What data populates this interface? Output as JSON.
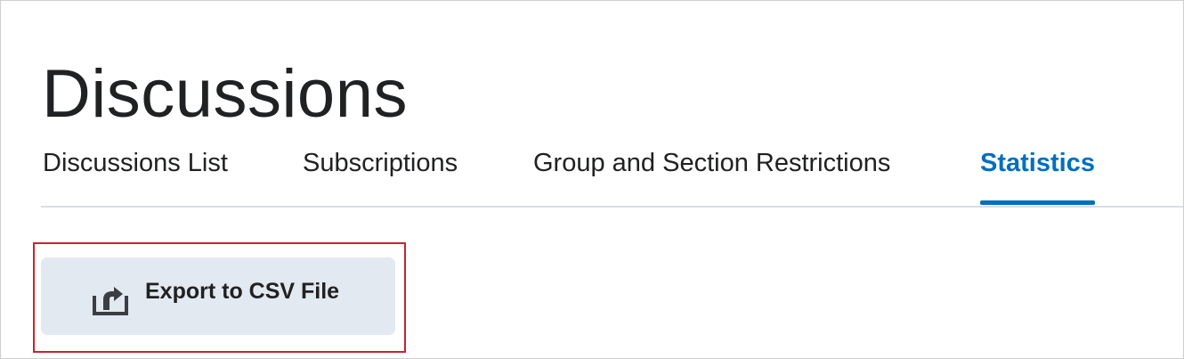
{
  "page": {
    "title": "Discussions"
  },
  "tabs": [
    {
      "label": "Discussions List",
      "active": false
    },
    {
      "label": "Subscriptions",
      "active": false
    },
    {
      "label": "Group and Section Restrictions",
      "active": false
    },
    {
      "label": "Statistics",
      "active": true
    }
  ],
  "toolbar": {
    "export_label": "Export to CSV File",
    "export_icon": "export-icon"
  },
  "colors": {
    "accent": "#006fbf",
    "button_bg": "#e3e9f1",
    "highlight": "#c8242f",
    "text": "#202122"
  }
}
